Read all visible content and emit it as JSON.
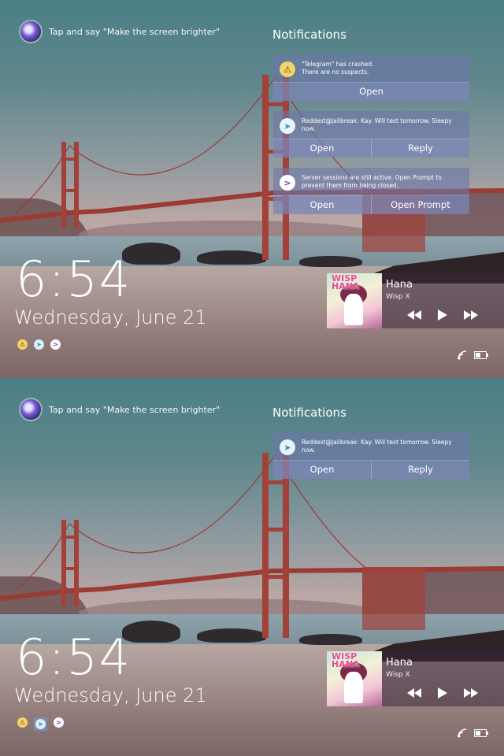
{
  "siri_hint": "Tap and say \"Make the screen brighter\"",
  "notifications_title": "Notifications",
  "clock": {
    "time": "6:54",
    "date": "Wednesday, June 21"
  },
  "media": {
    "song": "Hana",
    "artist": "Wisp X",
    "art_text": "WISP HANA"
  },
  "screens": [
    {
      "notifications": [
        {
          "icon": "warning-icon",
          "text": "\"Telegram\" has crashed.\nThere are no suspects.",
          "actions": [
            "Open"
          ]
        },
        {
          "icon": "telegram-icon",
          "text": "Reddest@Jailbreak: Kay. Will test tomorrow. Sleepy now.",
          "actions": [
            "Open",
            "Reply"
          ]
        },
        {
          "icon": "prompt-icon",
          "text": "Server sessions are still active. Open Prompt to prevent them from being closed.",
          "actions": [
            "Open",
            "Open Prompt"
          ]
        }
      ]
    },
    {
      "notifications": [
        {
          "icon": "telegram-icon",
          "text": "Reddest@Jailbreak: Kay. Will test tomorrow. Sleepy now.",
          "actions": [
            "Open",
            "Reply"
          ]
        }
      ]
    }
  ],
  "colors": {
    "card": "#6e78aa",
    "warn": "#f4d36a",
    "prompt": "#8a2fc7"
  }
}
